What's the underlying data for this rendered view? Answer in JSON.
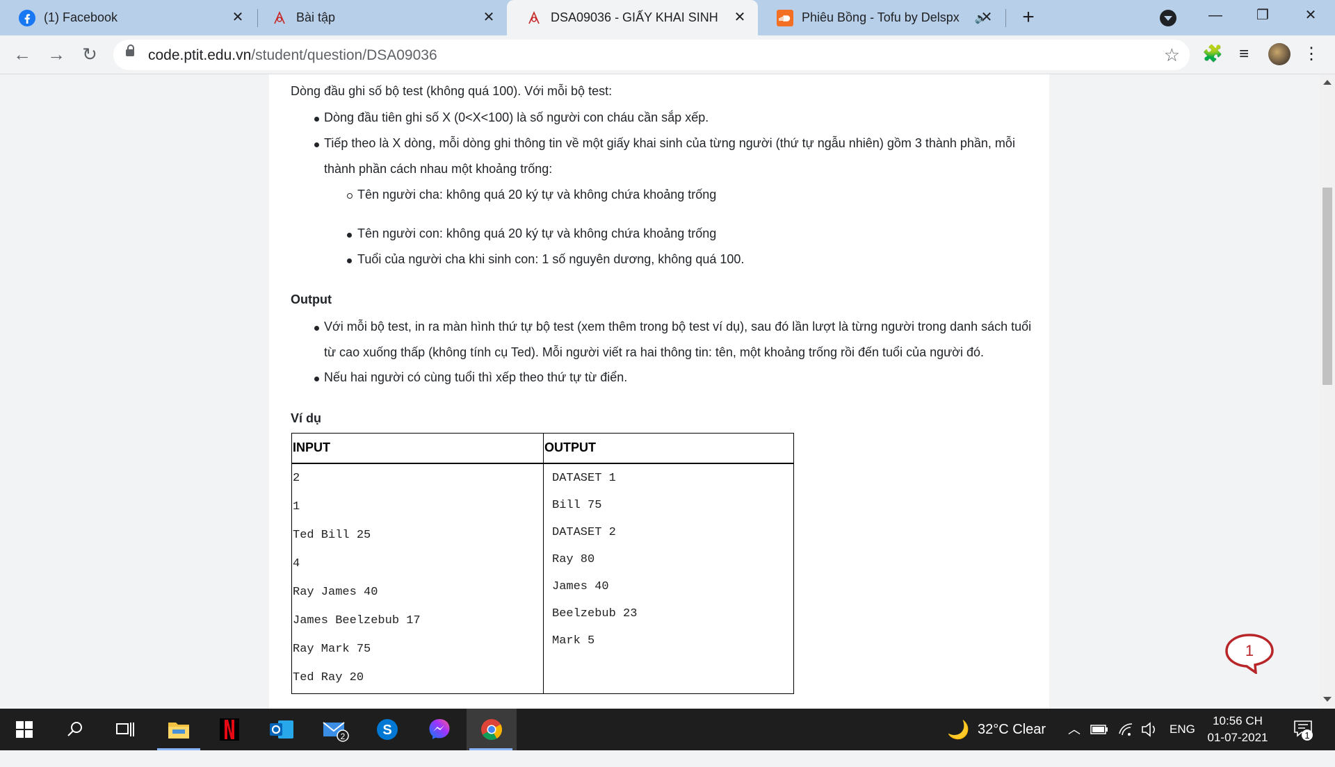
{
  "tabs": [
    {
      "label": "(1) Facebook",
      "icon": "facebook-icon"
    },
    {
      "label": "Bài tập",
      "icon": "ptit-icon"
    },
    {
      "label": "DSA09036 - GIẤY KHAI SINH",
      "icon": "ptit-icon"
    },
    {
      "label": "Phiêu Bồng - Tofu by Delspx",
      "icon": "soundcloud-icon"
    }
  ],
  "address": {
    "host": "code.ptit.edu.vn",
    "path": "/student/question/DSA09036"
  },
  "content": {
    "intro": "Dòng đầu ghi số bộ test (không quá 100). Với mỗi bộ test:",
    "input_bullets": [
      "Dòng đầu tiên ghi số X (0<X<100) là số người con cháu cần sắp xếp.",
      "Tiếp theo là X dòng, mỗi dòng ghi thông tin về một giấy khai sinh của từng người (thứ tự ngẫu nhiên) gồm 3 thành phần, mỗi",
      "thành phần cách nhau một khoảng trống:"
    ],
    "sub_bullets": [
      "Tên người cha: không quá 20 ký tự và không chứa khoảng trống",
      "Tên người con: không quá 20 ký tự và không chứa khoảng trống",
      "Tuổi của người cha khi sinh con: 1 số nguyên dương, không quá 100."
    ],
    "output_heading": "Output",
    "output_bullets": [
      "Với mỗi bộ test, in ra màn hình thứ tự bộ test (xem thêm trong bộ test ví dụ), sau đó lần lượt là từng người trong danh sách tuổi",
      "từ cao xuống thấp (không tính cụ Ted). Mỗi người viết ra hai thông tin: tên, một khoảng trống rồi đến tuổi của người đó.",
      "Nếu hai người có cùng tuổi thì xếp theo thứ tự từ điển."
    ],
    "example_heading": "Ví dụ",
    "table": {
      "input_header": "INPUT",
      "output_header": "OUTPUT",
      "input_lines": [
        "2",
        "1",
        "Ted Bill 25",
        "4",
        "Ray James 40",
        "James Beelzebub 17",
        "Ray Mark 75",
        "Ted Ray 20"
      ],
      "output_lines": [
        "DATASET 1",
        "Bill 75",
        "DATASET 2",
        "Ray 80",
        "James 40",
        "Beelzebub 23",
        "Mark 5"
      ]
    }
  },
  "chat_badge": "1",
  "taskbar": {
    "weather": "32°C  Clear",
    "language": "ENG",
    "time": "10:56 CH",
    "date": "01-07-2021",
    "mail_badge": "2",
    "notification_badge": "1"
  },
  "colors": {
    "accent": "#8ab4f8",
    "chat": "#b8262a",
    "tabstrip": "#b8cfe9"
  }
}
